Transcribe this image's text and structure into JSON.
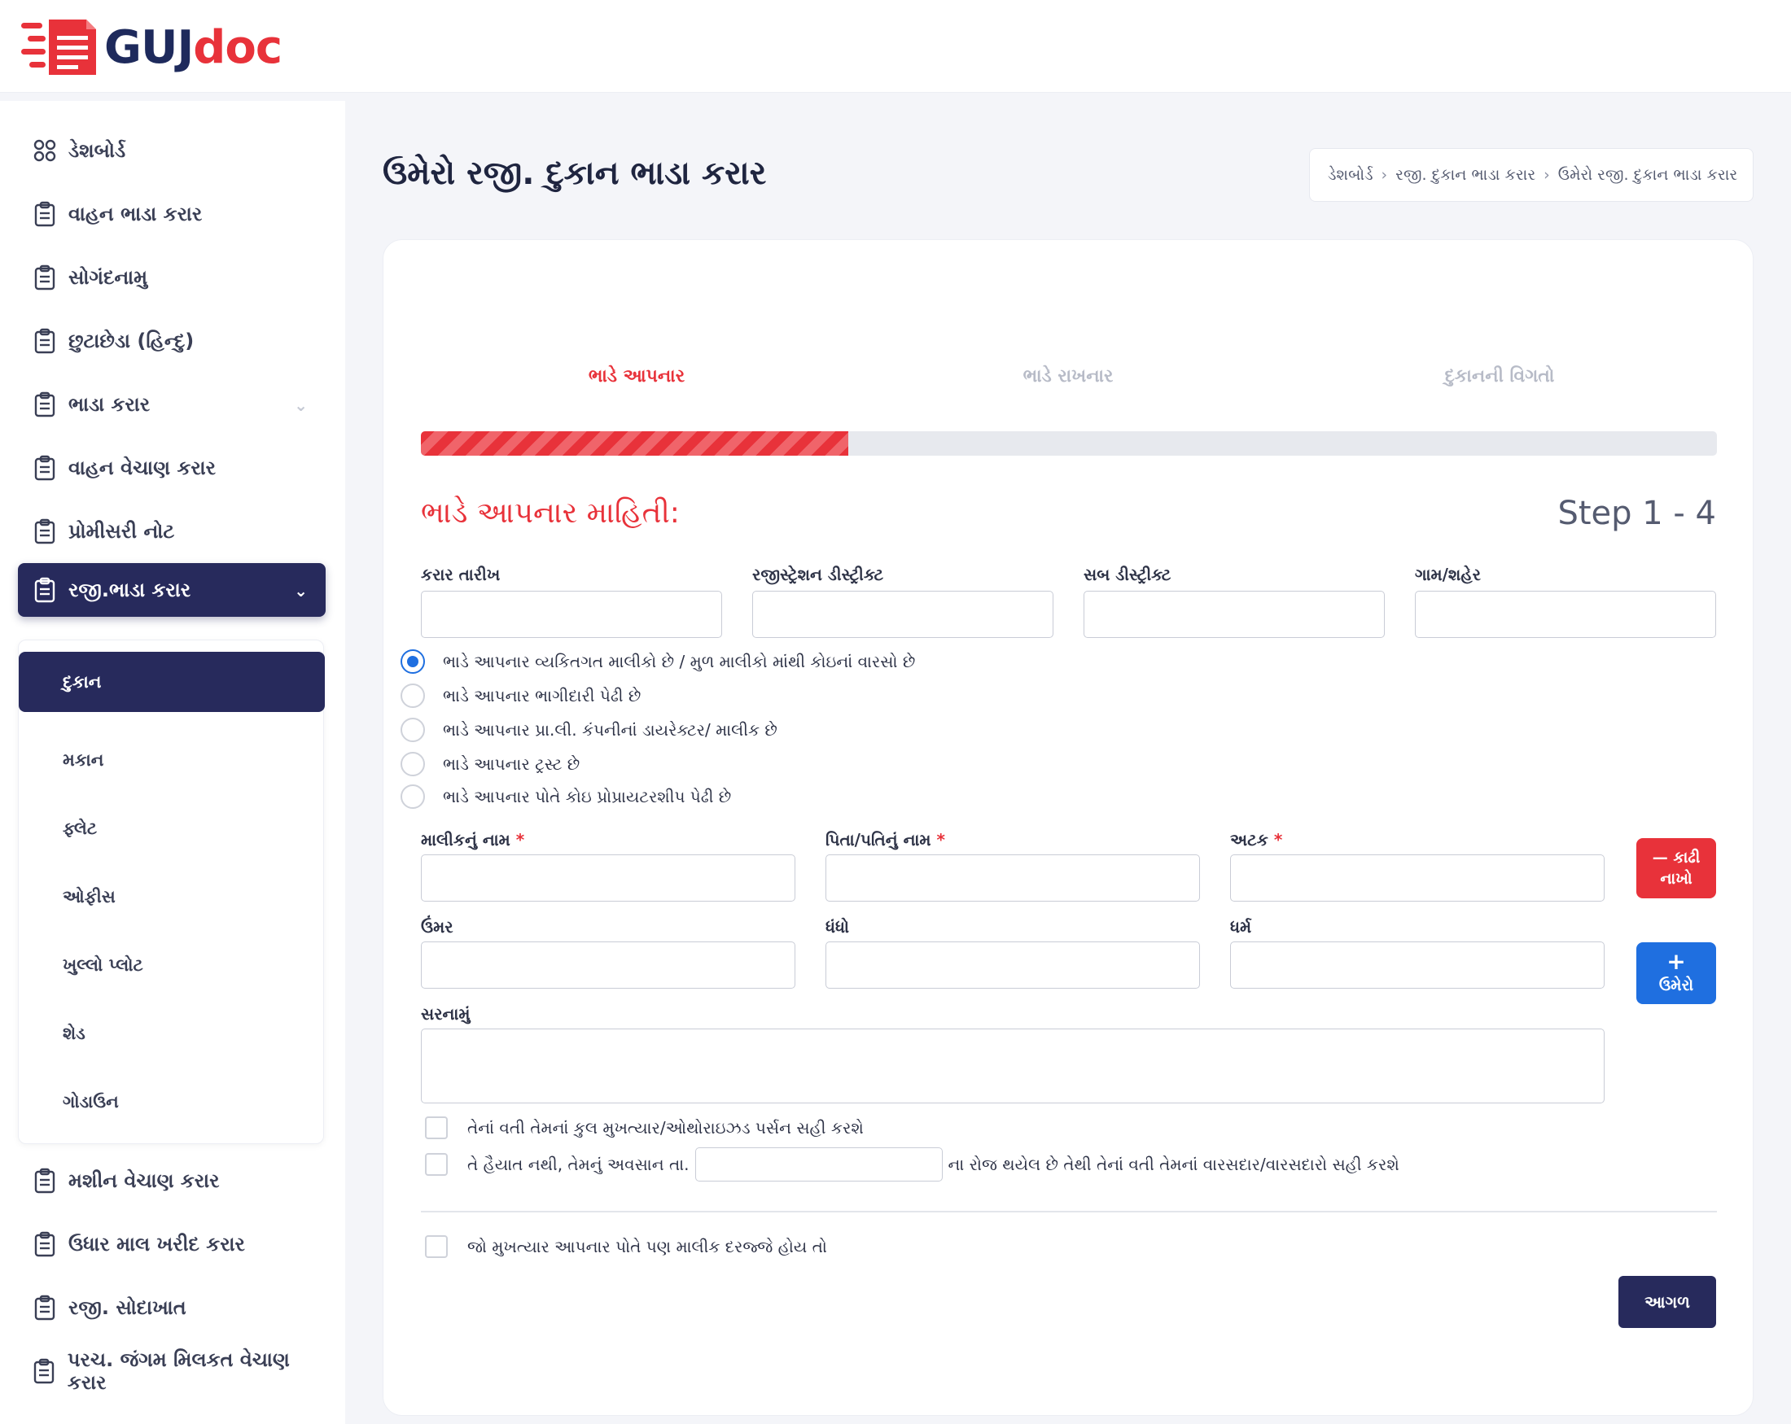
{
  "brand": {
    "part1": "GUJ",
    "part2": "doc",
    "colors": {
      "red": "#e8323a",
      "navy": "#1e2a5c"
    }
  },
  "sidebar": {
    "items": [
      {
        "label": "ડેશબોર્ડ",
        "icon": "dashboard-grid-icon"
      },
      {
        "label": "વાહન ભાડા કરાર",
        "icon": "clipboard-icon"
      },
      {
        "label": "સોગંદનામુ",
        "icon": "clipboard-icon"
      },
      {
        "label": "છુટાછેડા (હિન્દુ)",
        "icon": "clipboard-icon"
      },
      {
        "label": "ભાડા કરાર",
        "icon": "clipboard-icon"
      },
      {
        "label": "વાહન વેચાણ કરાર",
        "icon": "clipboard-icon"
      },
      {
        "label": "પ્રોમીસરી નોટ",
        "icon": "clipboard-icon"
      },
      {
        "label": "રજી.ભાડા કરાર",
        "icon": "clipboard-icon"
      },
      {
        "label": "મશીન વેચાણ કરાર",
        "icon": "clipboard-icon"
      },
      {
        "label": "ઉધાર માલ ખરીદ કરાર",
        "icon": "clipboard-icon"
      },
      {
        "label": "રજી. સોદાખાત",
        "icon": "clipboard-icon"
      },
      {
        "label": "પરચ. જંગમ મિલકત વેચાણ કરાર",
        "icon": "clipboard-icon"
      }
    ],
    "submenu": [
      "દુકાન",
      "મકાન",
      "ફ્લેટ",
      "ઓફીસ",
      "ખુલ્લો પ્લોટ",
      "શેડ",
      "ગોડાઉન"
    ]
  },
  "page": {
    "title": "ઉમેરો રજી. દુકાન ભાડા કરાર"
  },
  "breadcrumb": [
    "ડેશબોર્ડ",
    "રજી. દુકાન ભાડા કરાર",
    "ઉમેરો રજી. દુકાન ભાડા કરાર"
  ],
  "steps": {
    "tabs": [
      "ભાડે આપનાર",
      "ભાડે રાખનાર",
      "દુકાનની વિગતો"
    ],
    "progress_fraction": 0.33,
    "section_title": "ભાડે આપનાર માહિતી:",
    "step_label": "Step 1 - 4"
  },
  "form": {
    "date_label": "કરાર તારીખ",
    "reg_district_label": "રજીસ્ટ્રેશન ડીસ્ટ્રીક્ટ",
    "sub_district_label": "સબ ડીસ્ટ્રીક્ટ",
    "village_label": "ગામ/શહેર",
    "radios": [
      "ભાડે આપનાર વ્યકિતગત માલીકો છે / મુળ માલીકો માંથી કોઇનાં વારસો છે",
      "ભાડે આપનાર ભાગીદારી પેઢી છે",
      "ભાડે આપનાર પ્રા.લી. કંપનીનાં ડાયરેક્ટર/ માલીક છે",
      "ભાડે આપનાર ટ્રસ્ટ છે",
      "ભાડે આપનાર પોતે કોઇ પ્રોપ્રાયટરશીપ પેઢી છે"
    ],
    "owner_name_label": "માલીકનું નામ",
    "father_name_label": "પિતા/પતિનું નામ",
    "surname_label": "અટક",
    "required_mark": "*",
    "age_label": "ઉંમર",
    "occupation_label": "ધંધો",
    "religion_label": "ધર્મ",
    "address_label": "સરનામું",
    "remove_label_1": "— કાઢી",
    "remove_label_2": "નાખો",
    "add_label_1": "+",
    "add_label_2": "ઉમેરો",
    "check1": "તેનાં વતી તેમનાં કુલ મુખત્યાર/ઓથોરાઇઝડ પર્સન સહી કરશે",
    "check2_pre": "તે હૈયાત નથી, તેમનું અવસાન તા.",
    "check2_post": "ના રોજ થયેલ છે તેથી તેનાં વતી તેમનાં વારસદાર/વારસદારો સહી કરશે",
    "check3": "જો મુખત્યાર આપનાર પોતે પણ માલીક દરજ્જે હોય તો",
    "next_label": "આગળ"
  }
}
